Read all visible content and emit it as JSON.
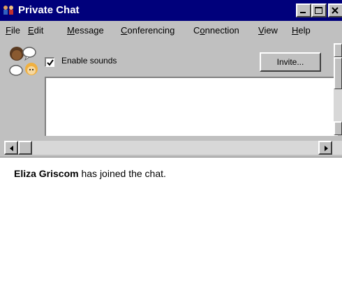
{
  "window": {
    "title": "Private Chat",
    "title_bar_color": "#00007b"
  },
  "menu": {
    "items": [
      {
        "pre": "",
        "key": "F",
        "post": "ile"
      },
      {
        "pre": "",
        "key": "E",
        "post": "dit"
      },
      {
        "pre": "",
        "key": "M",
        "post": "essage"
      },
      {
        "pre": "",
        "key": "C",
        "post": "onferencing"
      },
      {
        "pre": "C",
        "key": "o",
        "post": "nnection"
      },
      {
        "pre": "",
        "key": "V",
        "post": "iew"
      },
      {
        "pre": "",
        "key": "H",
        "post": "elp"
      }
    ]
  },
  "toolbar": {
    "enable_sounds_label": "Enable sounds",
    "enable_sounds_checked": true,
    "invite_label": "Invite..."
  },
  "transcript": {
    "messages": [
      {
        "user": "Eliza Griscom",
        "text": " has joined the chat."
      }
    ]
  },
  "icons": {
    "app": "chat-people-icon",
    "participants": "users-icon"
  }
}
